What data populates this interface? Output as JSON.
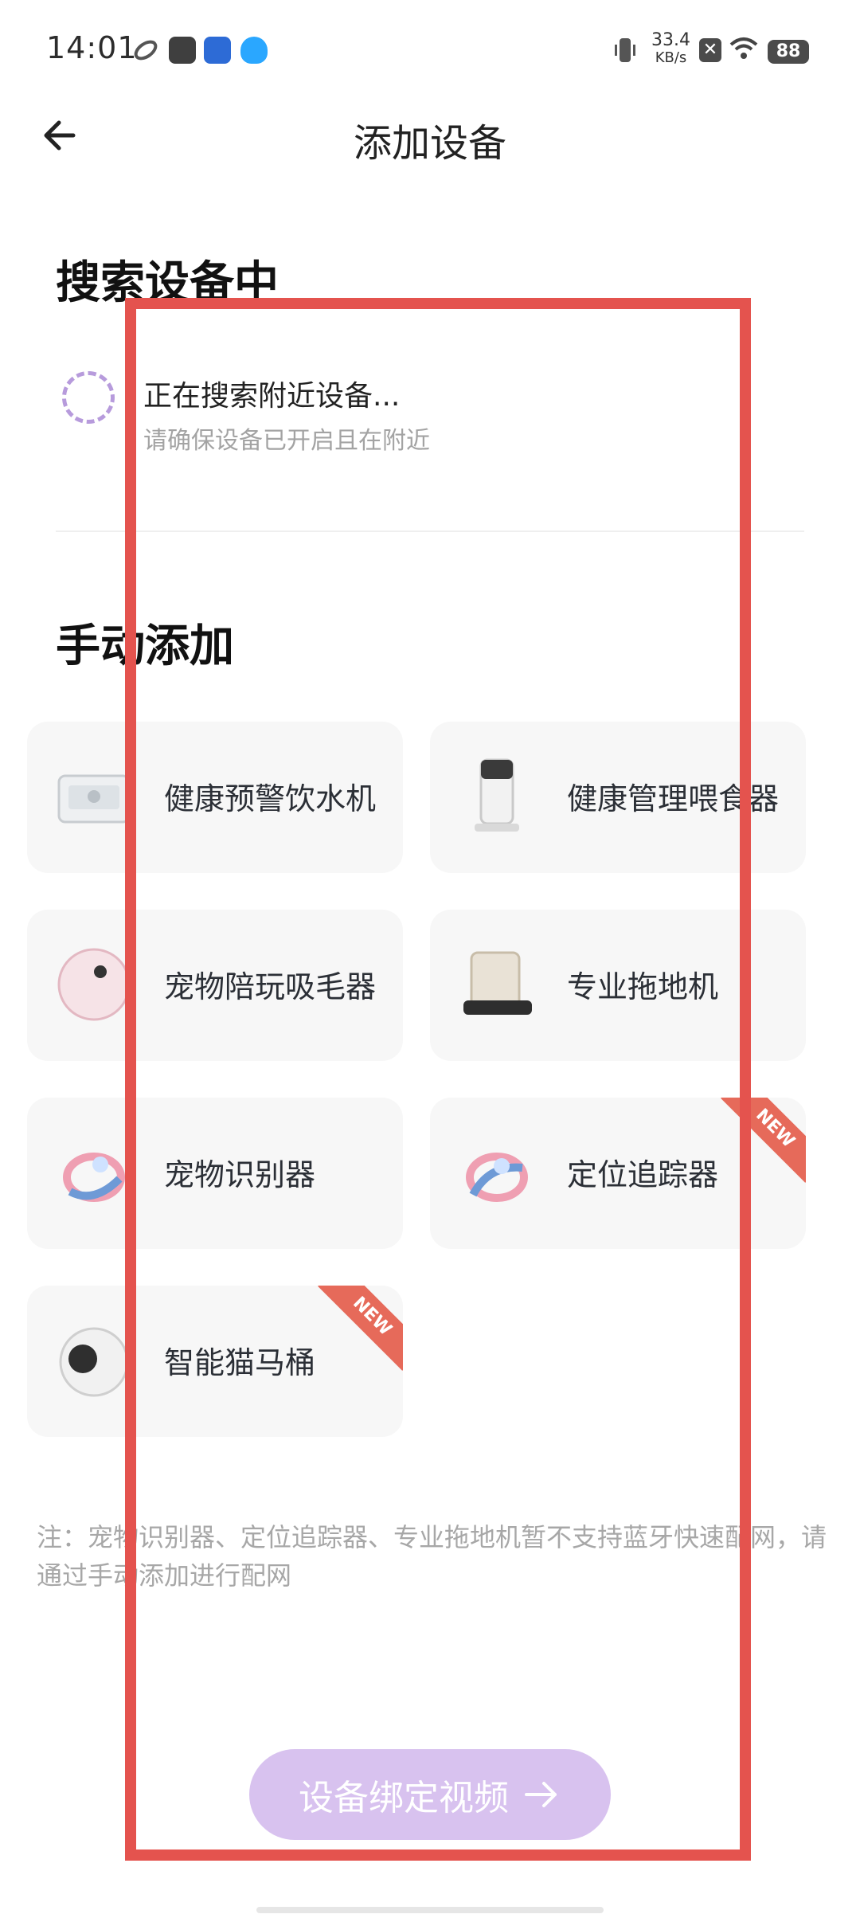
{
  "status_bar": {
    "time": "14:01",
    "net_speed_top": "33.4",
    "net_speed_bottom": "KB/s",
    "battery": "88"
  },
  "header": {
    "title": "添加设备"
  },
  "searching": {
    "title": "搜索设备中",
    "status": "正在搜索附近设备...",
    "hint": "请确保设备已开启且在附近"
  },
  "manual": {
    "title": "手动添加",
    "items": [
      {
        "label": "健康预警饮水机",
        "icon": "water-dispenser-icon",
        "badge": ""
      },
      {
        "label": "健康管理喂食器",
        "icon": "feeder-icon",
        "badge": ""
      },
      {
        "label": "宠物陪玩吸毛器",
        "icon": "hair-vacuum-icon",
        "badge": ""
      },
      {
        "label": "专业拖地机",
        "icon": "mopping-robot-icon",
        "badge": ""
      },
      {
        "label": "宠物识别器",
        "icon": "pet-collar-icon",
        "badge": ""
      },
      {
        "label": "定位追踪器",
        "icon": "tracker-collar-icon",
        "badge": "NEW"
      },
      {
        "label": "智能猫马桶",
        "icon": "cat-toilet-icon",
        "badge": "NEW"
      }
    ]
  },
  "note": "注：宠物识别器、定位追踪器、专业拖地机暂不支持蓝牙快速配网，请通过手动添加进行配网",
  "footer": {
    "video_button": "设备绑定视频"
  }
}
